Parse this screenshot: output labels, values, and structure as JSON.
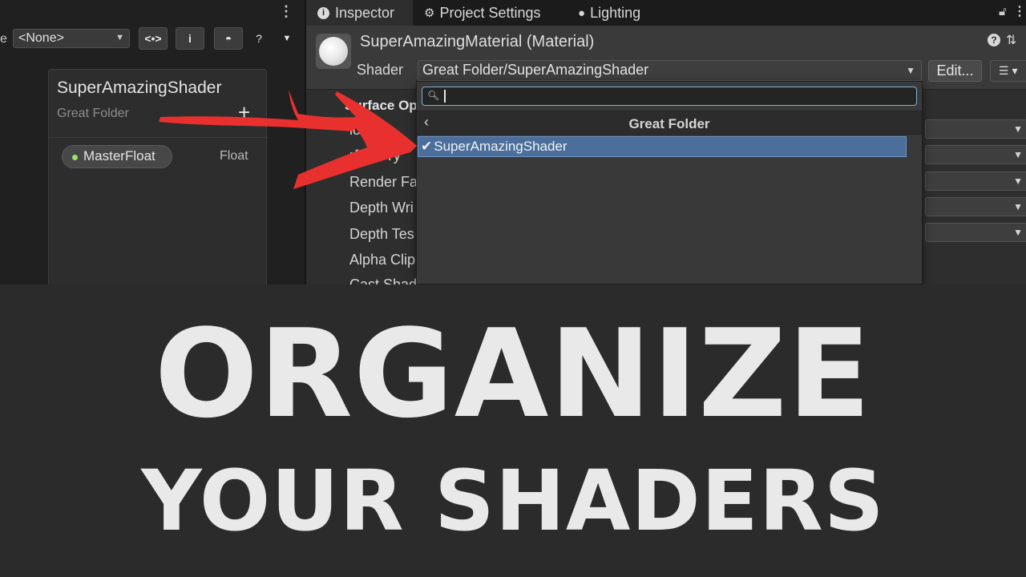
{
  "left_panel": {
    "toolbar_fragment": "e",
    "precision_value": "<None>",
    "buttons": [
      "<•>",
      "i",
      "◓",
      "?"
    ],
    "blackboard": {
      "title": "SuperAmazingShader",
      "subtitle": "Great Folder",
      "add_label": "+",
      "property": {
        "name": "MasterFloat",
        "type": "Float"
      }
    }
  },
  "tabs": [
    {
      "label": "Inspector",
      "icon": "info-icon",
      "active": true
    },
    {
      "label": "Project Settings",
      "icon": "gear-icon",
      "active": false
    },
    {
      "label": "Lighting",
      "icon": "bulb-icon",
      "active": false
    }
  ],
  "material": {
    "name": "SuperAmazingMaterial (Material)",
    "shader_label": "Shader",
    "shader_value": "Great Folder/SuperAmazingShader",
    "edit_label": "Edit..."
  },
  "properties": {
    "header": "Surface Op",
    "rows": [
      "low",
      "rface Ty",
      "Render Fa",
      "Depth Wri",
      "Depth Tes",
      "Alpha Clip",
      "Cast Shad"
    ]
  },
  "popup": {
    "search_value": "",
    "folder": "Great Folder",
    "selected_item": "SuperAmazingShader"
  },
  "banner": {
    "line1": "ORGANIZE",
    "line2": "YOUR SHADERS"
  },
  "colors": {
    "accent_selection": "#4b6f9a",
    "arrow": "#e8312f",
    "property_dot": "#9ee06b"
  }
}
